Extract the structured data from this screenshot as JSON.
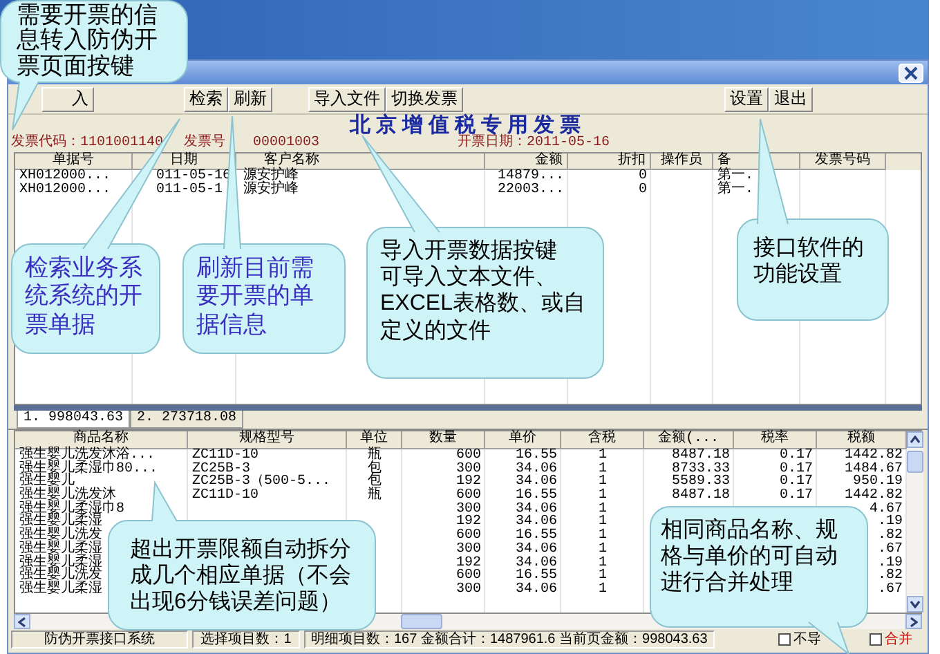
{
  "toolbar": [
    [
      "入"
    ],
    [
      "检索",
      "刷新"
    ],
    [
      "导入文件",
      "切换发票"
    ],
    [
      "设置",
      "退出"
    ]
  ],
  "invoice": {
    "title": "北京增值税专用发票",
    "code": "发票代码：1101001140",
    "number": "发票号",
    "number_value": "00001003",
    "date": "开票日期：2011-05-16"
  },
  "upper_table": {
    "columns": [
      "单据号",
      "日期",
      "客户名称",
      "金额",
      "折扣",
      "操作员",
      "备",
      "发票号码"
    ],
    "rows": [
      [
        "XH012000...",
        "011-05-16",
        "源安护峰",
        "14879...",
        "0",
        null,
        "第一.",
        null
      ],
      [
        "XH012000...",
        "011-05-1",
        "源安护峰",
        "22003...",
        "0",
        null,
        "第一.",
        null
      ]
    ]
  },
  "tabs": [
    {
      "label": "1. 998043.63",
      "selected": true
    },
    {
      "label": "2. 273718.08",
      "selected": false
    }
  ],
  "lower_table": {
    "columns": [
      "商品名称",
      "规格型号",
      "单位",
      "数量",
      "单价",
      "含税",
      "金额(...",
      "税率",
      "税额"
    ],
    "rows": [
      [
        "强生婴儿洗发沐浴...",
        "ZC11D-10",
        "瓶",
        "600",
        "16.55",
        "1",
        "8487.18",
        "0.17",
        "1442.82"
      ],
      [
        "强生婴儿柔湿巾80...",
        "ZC25B-3",
        "包",
        "300",
        "34.06",
        "1",
        "8733.33",
        "0.17",
        "1484.67"
      ],
      [
        "强生婴儿",
        "ZC25B-3（500-5...",
        "包",
        "192",
        "34.06",
        "1",
        "5589.33",
        "0.17",
        "950.19"
      ],
      [
        "强生婴儿洗发沐",
        "ZC11D-10",
        "瓶",
        "600",
        "16.55",
        "1",
        "8487.18",
        "0.17",
        "1442.82"
      ],
      [
        "强生婴儿柔湿巾8",
        null,
        null,
        "300",
        "34.06",
        "1",
        null,
        null,
        "4.67"
      ],
      [
        "强生婴儿柔湿",
        null,
        null,
        "192",
        "34.06",
        "1",
        null,
        null,
        ".19"
      ],
      [
        "强生婴儿洗发",
        null,
        null,
        "600",
        "16.55",
        "1",
        null,
        null,
        ".82"
      ],
      [
        "强生婴儿柔湿",
        null,
        null,
        "300",
        "34.06",
        "1",
        null,
        null,
        ".67"
      ],
      [
        "强生婴儿柔湿",
        null,
        null,
        "192",
        "34.06",
        "1",
        null,
        null,
        ".19"
      ],
      [
        "强生婴儿洗发",
        null,
        null,
        "600",
        "16.55",
        "1",
        null,
        null,
        ".82"
      ],
      [
        "强生婴儿柔湿",
        null,
        null,
        "300",
        "34.06",
        "1",
        null,
        null,
        ".67"
      ]
    ]
  },
  "status_bar": {
    "cells": [
      "防伪开票接口系统",
      "选择项目数：1",
      "明细项目数：167 金额合计：1487961.6 当前页金额：998043.63"
    ],
    "checkboxes": [
      {
        "label": "不导",
        "checked": false,
        "color": "#000000"
      },
      {
        "label": "合并",
        "checked": false,
        "color": "#cc0000"
      }
    ]
  },
  "callouts": [
    {
      "lines": [
        "需要开票的信",
        "息转入防伪开",
        "票页面按键"
      ],
      "color": "#000000"
    },
    {
      "lines": [
        "检索业务系",
        "统系统的开",
        "票单据"
      ],
      "color": "#3a2fc0"
    },
    {
      "lines": [
        "刷新目前需",
        "要开票的单",
        "据信息"
      ],
      "color": "#3a2fc0"
    },
    {
      "lines": [
        "导入开票数据按键",
        "可导入文本文件、",
        "EXCEL表格数、或自",
        "定义的文件"
      ],
      "color": "#000000"
    },
    {
      "lines": [
        "接口软件的",
        "功能设置"
      ],
      "color": "#000000"
    },
    {
      "lines": [
        "超出开票限额自动拆分",
        "成几个相应单据（不会",
        "出现6分钱误差问题）"
      ],
      "color": "#000000"
    },
    {
      "lines": [
        "相同商品名称、规",
        "格与单价的可自动",
        "进行合并处理"
      ],
      "color": "#000000"
    }
  ]
}
